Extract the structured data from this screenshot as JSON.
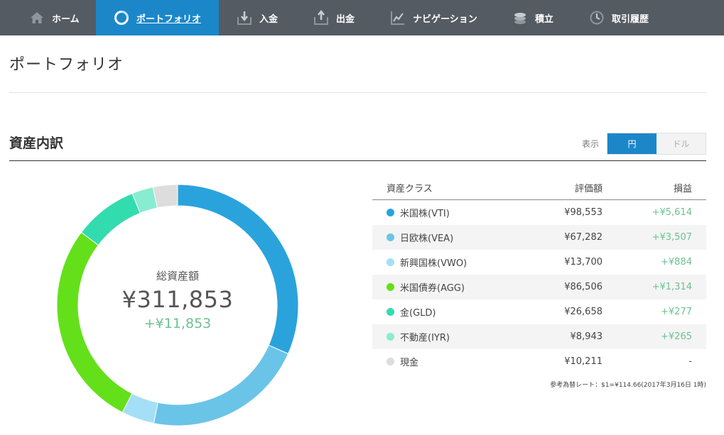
{
  "nav": {
    "items": [
      {
        "label": "ホーム",
        "icon": "home-icon",
        "active": false
      },
      {
        "label": "ポートフォリオ",
        "icon": "portfolio-ring-icon",
        "active": true
      },
      {
        "label": "入金",
        "icon": "deposit-icon",
        "active": false
      },
      {
        "label": "出金",
        "icon": "withdraw-icon",
        "active": false
      },
      {
        "label": "ナビゲーション",
        "icon": "chart-trend-icon",
        "active": false
      },
      {
        "label": "積立",
        "icon": "coins-icon",
        "active": false
      },
      {
        "label": "取引履歴",
        "icon": "clock-icon",
        "active": false
      }
    ]
  },
  "page": {
    "title": "ポートフォリオ"
  },
  "breakdown": {
    "title": "資産内訳",
    "display_label": "表示",
    "toggle": {
      "yen": "円",
      "dollar": "ドル",
      "selected": "yen"
    }
  },
  "summary": {
    "label": "総資産額",
    "total": "¥311,853",
    "gain": "+¥11,853"
  },
  "table": {
    "headers": {
      "asset_class": "資産クラス",
      "valuation": "評価額",
      "profit_loss": "損益"
    },
    "rows": [
      {
        "name": "米国株(VTI)",
        "value": "¥98,553",
        "pl": "+¥5,614",
        "color": "#2aa3dc",
        "amount": 98553
      },
      {
        "name": "日欧株(VEA)",
        "value": "¥67,282",
        "pl": "+¥3,507",
        "color": "#6ac4e8",
        "amount": 67282
      },
      {
        "name": "新興国株(VWO)",
        "value": "¥13,700",
        "pl": "+¥884",
        "color": "#a4dff7",
        "amount": 13700
      },
      {
        "name": "米国債券(AGG)",
        "value": "¥86,506",
        "pl": "+¥1,314",
        "color": "#63e01a",
        "amount": 86506
      },
      {
        "name": "金(GLD)",
        "value": "¥26,658",
        "pl": "+¥277",
        "color": "#33dcae",
        "amount": 26658
      },
      {
        "name": "不動産(IYR)",
        "value": "¥8,943",
        "pl": "+¥265",
        "color": "#88ecd0",
        "amount": 8943
      },
      {
        "name": "現金",
        "value": "¥10,211",
        "pl": "-",
        "color": "#dddddd",
        "amount": 10211
      }
    ],
    "footnote": "参考為替レート：$1=¥114.66(2017年3月16日 1時)"
  }
}
